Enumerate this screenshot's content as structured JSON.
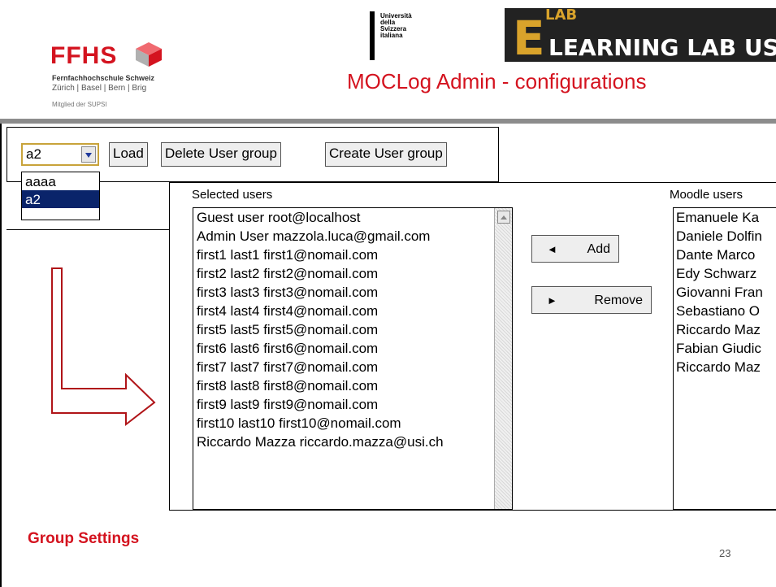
{
  "header": {
    "ffhs_logo": "FFHS",
    "ffhs_line1": "Fernfachhochschule Schweiz",
    "ffhs_line2": "Zürich | Basel | Bern | Brig",
    "ffhs_line3": "Mitglied der SUPSI",
    "usi_lines": [
      "Università",
      "della",
      "Svizzera",
      "italiana"
    ],
    "elab_lab": "LAB",
    "elab_main": "LEARNING LAB US",
    "title": "MOCLog  Admin - configurations"
  },
  "toolbar": {
    "combo_value": "a2",
    "load_label": "Load",
    "delete_label": "Delete User group",
    "create_label": "Create User group",
    "dropdown_options": [
      "aaaa",
      "a2"
    ],
    "dropdown_selected": "a2"
  },
  "selected_users": {
    "label": "Selected users",
    "items": [
      "Guest user root@localhost",
      "Admin User mazzola.luca@gmail.com",
      "first1 last1 first1@nomail.com",
      "first2 last2 first2@nomail.com",
      "first3 last3 first3@nomail.com",
      "first4 last4 first4@nomail.com",
      "first5 last5 first5@nomail.com",
      "first6 last6 first6@nomail.com",
      "first7 last7 first7@nomail.com",
      "first8 last8 first8@nomail.com",
      "first9 last9 first9@nomail.com",
      "first10 last10 first10@nomail.com",
      "Riccardo Mazza riccardo.mazza@usi.ch"
    ]
  },
  "actions": {
    "add_label": "Add",
    "remove_label": "Remove"
  },
  "moodle_users": {
    "label": "Moodle users",
    "items": [
      "Emanuele Ka",
      "Daniele Dolfin",
      "Dante Marco",
      "Edy Schwarz",
      "Giovanni Fran",
      "Sebastiano O",
      "Riccardo Maz",
      "Fabian Giudic",
      "Riccardo Maz"
    ]
  },
  "footer": {
    "group_settings": "Group Settings",
    "page_number": "23"
  },
  "colors": {
    "brand_red": "#d4131f",
    "selection_blue": "#0a246a",
    "elab_gold": "#d9a32b"
  }
}
